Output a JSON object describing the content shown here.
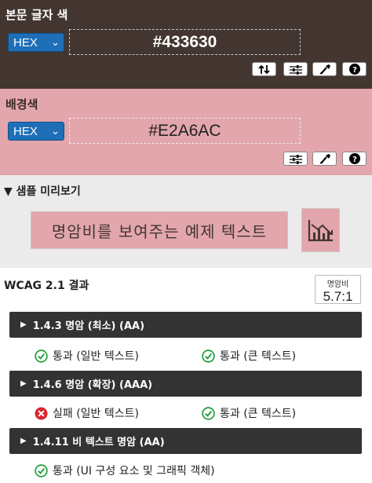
{
  "foreground": {
    "title": "본문 글자 색",
    "format": "HEX",
    "value": "#433630",
    "color": "#433630"
  },
  "background": {
    "title": "배경색",
    "format": "HEX",
    "value": "#E2A6AC",
    "color": "#E2A6AC"
  },
  "preview": {
    "toggle_label": "▼ 샘플 미리보기",
    "sample_text": "명암비를 보여주는 예제 텍스트"
  },
  "results": {
    "title": "WCAG 2.1 결과",
    "ratio_label": "명암비",
    "ratio_value": "5.7:1",
    "criteria": [
      {
        "label": "1.4.3 명암 (최소) (AA)",
        "items": [
          {
            "status": "pass",
            "text": "통과 (일반 텍스트)"
          },
          {
            "status": "pass",
            "text": "통과 (큰 텍스트)"
          }
        ]
      },
      {
        "label": "1.4.6 명암 (확장) (AAA)",
        "items": [
          {
            "status": "fail",
            "text": "실패 (일반 텍스트)"
          },
          {
            "status": "pass",
            "text": "통과 (큰 텍스트)"
          }
        ]
      },
      {
        "label": "1.4.11 비 텍스트 명암 (AA)",
        "items": [
          {
            "status": "pass",
            "text": "통과 (UI 구성 요소 및 그래픽 객체)"
          }
        ]
      }
    ]
  },
  "icons": {
    "swap": "swap-arrows-icon",
    "adjust": "sliders-icon",
    "picker": "eyedropper-icon",
    "help": "help-icon",
    "graph": "chart-icon",
    "pass": "check-circle-icon",
    "fail": "x-circle-icon"
  },
  "colors": {
    "pass": "#1f9d3a",
    "fail": "#d9262e",
    "select": "#1e6fb8",
    "bar": "#333333"
  }
}
